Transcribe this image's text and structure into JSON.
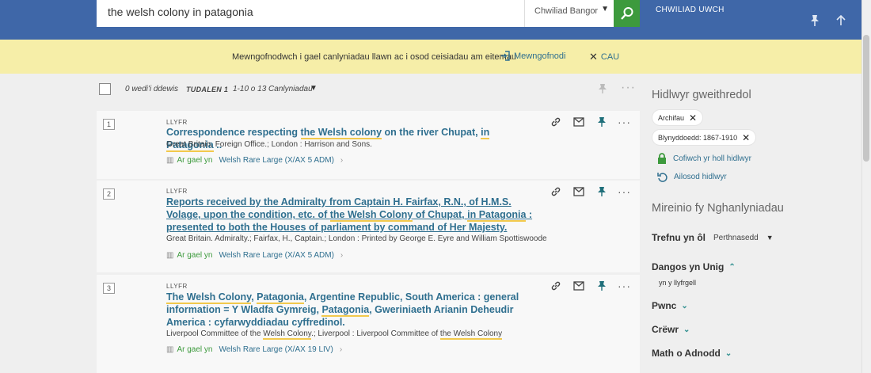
{
  "search": {
    "query": "the welsh colony in patagonia",
    "scope": "Chwiliad Bangor",
    "advanced_label": "CHWILIAD UWCH"
  },
  "banner": {
    "text": "Mewngofnodwch i gael canlyniadau llawn ac i osod ceisiadau am eitemau",
    "login": "Mewngofnodi",
    "close": "CAU"
  },
  "toolbar": {
    "selected": "0 wedi'i ddewis",
    "page_label": "TUDALEN 1",
    "range": "1-10 o 13 Canlyniadau"
  },
  "results": [
    {
      "num": "1",
      "type": "LLYFR",
      "title_parts": [
        "Correspondence respecting ",
        "the Welsh colony",
        " on the river Chupat, ",
        "in Patagonia",
        " .."
      ],
      "author": "Great Britain. Foreign Office.; London : Harrison and Sons.",
      "avail": "Ar gael yn",
      "location": "Welsh Rare Large (X/AX 5 ADM)"
    },
    {
      "num": "2",
      "type": "LLYFR",
      "title_parts": [
        "Reports received by the Admiralty from Captain H. Fairfax, R.N., of H.M.S. Volage, upon the condition, etc. of ",
        "the Welsh Colony",
        " of Chupat, ",
        "in Patagonia",
        " : presented to both the Houses of parliament by command of Her Majesty."
      ],
      "author": "Great Britain. Admiralty.; Fairfax, H., Captain.; London : Printed by George E. Eyre and William Spottiswoode",
      "avail": "Ar gael yn",
      "location": "Welsh Rare Large (X/AX 5 ADM)"
    },
    {
      "num": "3",
      "type": "LLYFR",
      "title_parts": [
        "The Welsh Colony",
        ", ",
        "Patagonia",
        ", Argentine Republic, South America : general information = Y Wladfa Gymreig, ",
        "Patagonia",
        ", Gweriniaeth Arianin Deheudir America : cyfarwyddiadau cyffredinol."
      ],
      "author_parts": [
        "Liverpool Committee of the ",
        "Welsh Colony",
        ".; Liverpool : Liverpool Committee of ",
        "the Welsh Colony"
      ],
      "avail": "Ar gael yn",
      "location": "Welsh Rare Large (X/AX 19 LIV)"
    }
  ],
  "sidebar": {
    "active_filters_title": "Hidlwyr gweithredol",
    "chips": [
      "Archifau",
      "Blynyddoedd: 1867-1910"
    ],
    "remember_all": "Cofiwch yr holl hidlwyr",
    "reset": "Ailosod hidlwyr",
    "refine_title": "Mireinio fy Nghanlyniadau",
    "sort_label": "Trefnu yn ôl",
    "sort_value": "Perthnasedd",
    "show_only": "Dangos yn Unig",
    "show_only_item": "yn y llyfrgell",
    "facets": [
      "Pwnc",
      "Crëwr",
      "Math o Adnodd"
    ]
  }
}
